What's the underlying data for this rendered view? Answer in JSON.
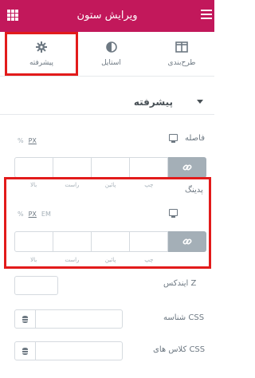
{
  "header": {
    "title": "ویرایش ستون",
    "menu_icon": "hamburger-icon",
    "grid_icon": "apps-grid-icon"
  },
  "tabs": [
    {
      "label": "طرح‌بندی",
      "icon": "columns-icon"
    },
    {
      "label": "استایل",
      "icon": "contrast-icon"
    },
    {
      "label": "پیشرفته",
      "icon": "gear-icon"
    }
  ],
  "section": {
    "title": "پیشرفته"
  },
  "margin": {
    "label": "فاصله",
    "units": [
      "PX",
      "%"
    ],
    "dims": [
      "بالا",
      "راست",
      "پائین",
      "چپ"
    ]
  },
  "padding": {
    "label": "پدینگ",
    "units": [
      "PX",
      "EM",
      "%"
    ],
    "dims": [
      "بالا",
      "راست",
      "پائین",
      "چپ"
    ]
  },
  "zindex": {
    "label": "ایندکس Z",
    "value": ""
  },
  "css_id": {
    "label": "شناسه CSS",
    "value": ""
  },
  "css_classes": {
    "label": "کلاس های CSS",
    "value": ""
  }
}
